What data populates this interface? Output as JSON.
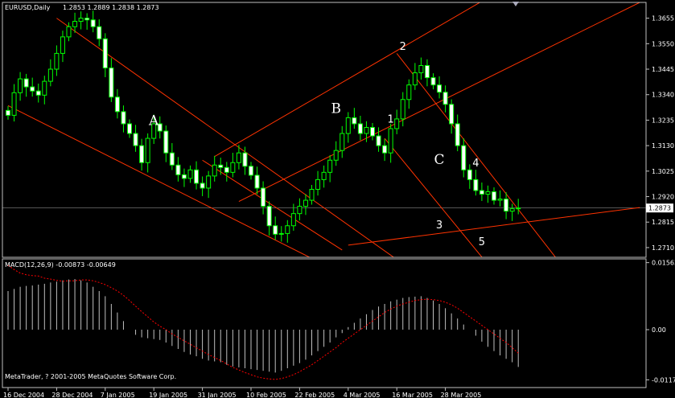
{
  "chart_data": {
    "type": "candlestick",
    "title": "EURUSD,Daily",
    "ohlc_text": "1.2853 1.2889 1.2838 1.2873",
    "current_price": "1.2873",
    "ylim": [
      1.267,
      1.372
    ],
    "price_ticks": [
      {
        "label": "1.3655",
        "value": 1.3655
      },
      {
        "label": "1.3550",
        "value": 1.355
      },
      {
        "label": "1.3445",
        "value": 1.3445
      },
      {
        "label": "1.3340",
        "value": 1.334
      },
      {
        "label": "1.3235",
        "value": 1.3235
      },
      {
        "label": "1.3130",
        "value": 1.313
      },
      {
        "label": "1.3025",
        "value": 1.3025
      },
      {
        "label": "1.2920",
        "value": 1.292
      },
      {
        "label": "1.2815",
        "value": 1.2815
      },
      {
        "label": "1.2710",
        "value": 1.271
      }
    ],
    "date_ticks": [
      {
        "label": "16 Dec 2004",
        "index": 0
      },
      {
        "label": "28 Dec 2004",
        "index": 8
      },
      {
        "label": "7 Jan 2005",
        "index": 16
      },
      {
        "label": "19 Jan 2005",
        "index": 24
      },
      {
        "label": "31 Jan 2005",
        "index": 32
      },
      {
        "label": "10 Feb 2005",
        "index": 40
      },
      {
        "label": "22 Feb 2005",
        "index": 48
      },
      {
        "label": "4 Mar 2005",
        "index": 56
      },
      {
        "label": "16 Mar 2005",
        "index": 64
      },
      {
        "label": "28 Mar 2005",
        "index": 72
      }
    ],
    "closes": [
      1.3255,
      1.3348,
      1.3405,
      1.3372,
      1.3355,
      1.3338,
      1.3395,
      1.3445,
      1.351,
      1.3578,
      1.362,
      1.3642,
      1.3655,
      1.3648,
      1.362,
      1.357,
      1.345,
      1.333,
      1.327,
      1.322,
      1.318,
      1.313,
      1.306,
      1.316,
      1.322,
      1.319,
      1.31,
      1.305,
      1.301,
      1.2995,
      1.303,
      1.2975,
      1.2955,
      1.3005,
      1.305,
      1.304,
      1.302,
      1.306,
      1.31,
      1.3045,
      1.3008,
      1.2955,
      1.288,
      1.28,
      1.2765,
      1.2768,
      1.28,
      1.285,
      1.288,
      1.2905,
      1.295,
      1.299,
      1.302,
      1.307,
      1.311,
      1.318,
      1.3245,
      1.322,
      1.318,
      1.3205,
      1.317,
      1.313,
      1.31,
      1.32,
      1.324,
      1.332,
      1.338,
      1.343,
      1.346,
      1.341,
      1.338,
      1.335,
      1.33,
      1.322,
      1.313,
      1.303,
      1.299,
      1.2945,
      1.293,
      1.294,
      1.2905,
      1.291,
      1.286,
      1.287,
      1.2873
    ],
    "macd": {
      "label": "MACD(12,26,9) -0.00873 -0.00649",
      "ylim": [
        -0.0135,
        0.0165
      ],
      "ticks": [
        {
          "label": "0.01563",
          "value": 0.01563
        },
        {
          "label": "0.00",
          "value": 0
        },
        {
          "label": "-0.0117",
          "value": -0.0117
        }
      ],
      "histogram": [
        0.009,
        0.0095,
        0.01,
        0.0102,
        0.0103,
        0.0105,
        0.0107,
        0.011,
        0.0112,
        0.0115,
        0.0117,
        0.0118,
        0.0115,
        0.011,
        0.01,
        0.009,
        0.0078,
        0.006,
        0.004,
        0.002,
        0.0,
        -0.0012,
        -0.0018,
        -0.002,
        -0.0022,
        -0.0024,
        -0.003,
        -0.0038,
        -0.0045,
        -0.0052,
        -0.0058,
        -0.0062,
        -0.0068,
        -0.0072,
        -0.0074,
        -0.0076,
        -0.0082,
        -0.0086,
        -0.0088,
        -0.009,
        -0.0092,
        -0.0094,
        -0.0096,
        -0.0098,
        -0.01,
        -0.0096,
        -0.009,
        -0.0084,
        -0.0078,
        -0.007,
        -0.006,
        -0.005,
        -0.004,
        -0.003,
        -0.0018,
        -0.0008,
        0.0006,
        0.0016,
        0.0026,
        0.0036,
        0.0046,
        0.0054,
        0.006,
        0.0066,
        0.007,
        0.0074,
        0.0076,
        0.0077,
        0.0078,
        0.0074,
        0.0068,
        0.006,
        0.005,
        0.0038,
        0.0026,
        0.0012,
        0.0,
        -0.0014,
        -0.0028,
        -0.004,
        -0.005,
        -0.006,
        -0.0068,
        -0.0076,
        -0.0087
      ],
      "signal": [
        0.015,
        0.014,
        0.0132,
        0.0128,
        0.0126,
        0.0125,
        0.012,
        0.0118,
        0.0115,
        0.0113,
        0.0114,
        0.0114,
        0.0116,
        0.0116,
        0.0114,
        0.011,
        0.0105,
        0.0098,
        0.009,
        0.008,
        0.0068,
        0.0055,
        0.0042,
        0.003,
        0.0018,
        0.0008,
        0.0,
        -0.001,
        -0.0018,
        -0.0026,
        -0.0034,
        -0.0042,
        -0.005,
        -0.0058,
        -0.0065,
        -0.0072,
        -0.008,
        -0.0088,
        -0.0094,
        -0.01,
        -0.0105,
        -0.011,
        -0.0113,
        -0.0115,
        -0.0116,
        -0.0114,
        -0.011,
        -0.0105,
        -0.0098,
        -0.009,
        -0.0082,
        -0.0072,
        -0.0062,
        -0.0052,
        -0.0042,
        -0.003,
        -0.002,
        -0.001,
        0.0,
        0.001,
        0.002,
        0.003,
        0.004,
        0.0048,
        0.0055,
        0.006,
        0.0064,
        0.0068,
        0.007,
        0.0071,
        0.007,
        0.0068,
        0.0064,
        0.0058,
        0.005,
        0.004,
        0.003,
        0.002,
        0.001,
        0.0,
        -0.001,
        -0.002,
        -0.003,
        -0.0042,
        -0.0055
      ]
    },
    "annotations": [
      {
        "text": "A",
        "index": 24,
        "value": 1.3215,
        "style": "serif"
      },
      {
        "text": "B",
        "index": 54,
        "value": 1.3265,
        "style": "serif"
      },
      {
        "text": "C",
        "index": 71,
        "value": 1.3055,
        "style": "serif"
      },
      {
        "text": "1",
        "index": 63,
        "value": 1.3225,
        "style": "sans"
      },
      {
        "text": "2",
        "index": 65,
        "value": 1.3525,
        "style": "sans"
      },
      {
        "text": "3",
        "index": 71,
        "value": 1.279,
        "style": "sans"
      },
      {
        "text": "4",
        "index": 77,
        "value": 1.3045,
        "style": "sans"
      },
      {
        "text": "5",
        "index": 78,
        "value": 1.272,
        "style": "sans"
      }
    ],
    "trendlines": [
      {
        "i1": 8,
        "v1": 1.3655,
        "i2": 68,
        "v2": 1.259
      },
      {
        "i1": 0,
        "v1": 1.3295,
        "i2": 56,
        "v2": 1.259
      },
      {
        "i1": 34,
        "v1": 1.3085,
        "i2": 88,
        "v2": 1.387
      },
      {
        "i1": 38,
        "v1": 1.29,
        "i2": 104,
        "v2": 1.372
      },
      {
        "i1": 56,
        "v1": 1.272,
        "i2": 104,
        "v2": 1.2875
      },
      {
        "i1": 64,
        "v1": 1.351,
        "i2": 92,
        "v2": 1.261
      },
      {
        "i1": 62,
        "v1": 1.316,
        "i2": 80,
        "v2": 1.261
      },
      {
        "i1": 32,
        "v1": 1.307,
        "i2": 55,
        "v2": 1.27
      }
    ],
    "colors": {
      "background": "#000000",
      "candle": "#00ff00",
      "bull_body": "#000000",
      "bear_body": "#ffffff",
      "trend": "#ff3300",
      "macd_hist": "#c0c0c0",
      "macd_signal": "#ff0000",
      "grid": "#333333",
      "axis": "#c0c0c0",
      "text": "#ffffff"
    }
  },
  "footer": {
    "copyright": "MetaTrader, ? 2001-2005 MetaQuotes Software Corp."
  }
}
